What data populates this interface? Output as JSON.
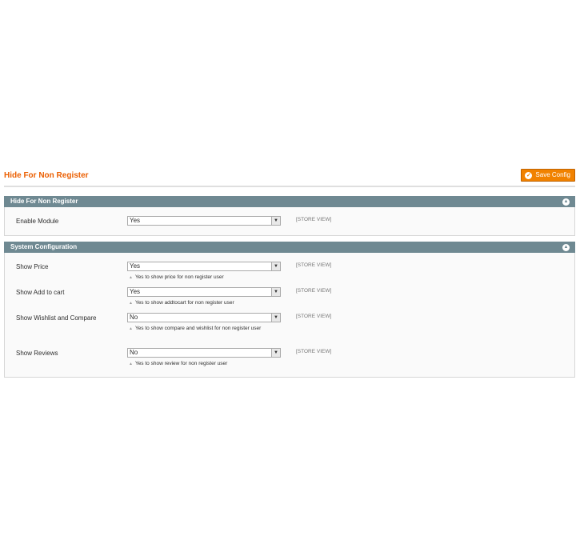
{
  "page": {
    "title": "Hide For Non Register",
    "save_label": "Save Config"
  },
  "sections": [
    {
      "title": "Hide For Non Register",
      "rows": [
        {
          "label": "Enable Module",
          "value": "Yes",
          "scope": "[STORE VIEW]"
        }
      ]
    },
    {
      "title": "System Configuration",
      "rows": [
        {
          "label": "Show Price",
          "value": "Yes",
          "scope": "[STORE VIEW]",
          "note": "Yes to show price for non register user"
        },
        {
          "label": "Show Add to cart",
          "value": "Yes",
          "scope": "[STORE VIEW]",
          "note": "Yes to show addtocart for non register user"
        },
        {
          "label": "Show Wishlist and Compare",
          "value": "No",
          "scope": "[STORE VIEW]",
          "note": "Yes to show compare and wishlist for non register user"
        },
        {
          "label": "Show Reviews",
          "value": "No",
          "scope": "[STORE VIEW]",
          "note": "Yes to show review for non register user"
        }
      ]
    }
  ],
  "icons": {
    "save": "check-circle-icon",
    "collapse": "collapse-up-icon",
    "dropdown": "chevron-down-icon",
    "note": "triangle-up-icon"
  },
  "colors": {
    "title": "#eb5e00",
    "button": "#f18200",
    "section_header": "#6f8992"
  }
}
